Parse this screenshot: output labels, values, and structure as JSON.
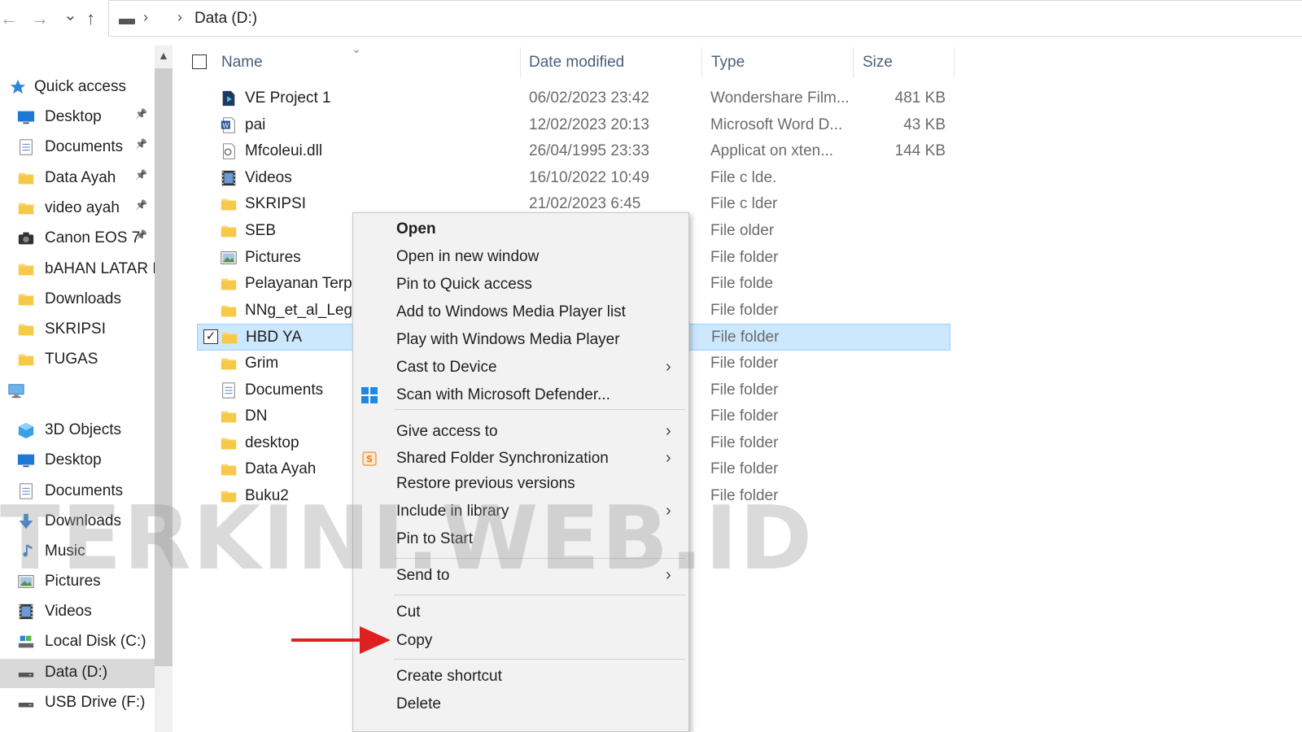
{
  "address": {
    "nav_back": "←",
    "nav_forward": "→",
    "nav_recent": "⌄",
    "nav_up": "↑",
    "path": "Data (D:)"
  },
  "sidebar": {
    "items": [
      {
        "label": "Quick access",
        "icon": "star-icon"
      },
      {
        "label": "Desktop",
        "icon": "desktop-icon",
        "pinned": true
      },
      {
        "label": "Documents",
        "icon": "documents-icon",
        "pinned": true
      },
      {
        "label": "Data Ayah",
        "icon": "folder-icon",
        "pinned": true
      },
      {
        "label": "video ayah",
        "icon": "folder-icon",
        "pinned": true
      },
      {
        "label": "Canon EOS 7",
        "icon": "camera-icon",
        "pinned": true
      },
      {
        "label": "bAHAN LATAR E",
        "icon": "folder-icon"
      },
      {
        "label": "Downloads",
        "icon": "folder-icon"
      },
      {
        "label": "SKRIPSI",
        "icon": "folder-icon"
      },
      {
        "label": "TUGAS",
        "icon": "folder-icon"
      },
      {
        "label": "",
        "icon": "this-pc-icon"
      },
      {
        "label": "3D Objects",
        "icon": "cube-icon"
      },
      {
        "label": "Desktop",
        "icon": "desktop-icon"
      },
      {
        "label": "Documents",
        "icon": "documents-icon"
      },
      {
        "label": "Downloads",
        "icon": "download-icon"
      },
      {
        "label": "Music",
        "icon": "music-icon"
      },
      {
        "label": "Pictures",
        "icon": "pictures-icon"
      },
      {
        "label": "Videos",
        "icon": "videos-icon"
      },
      {
        "label": "Local Disk (C:)",
        "icon": "disk-icon"
      },
      {
        "label": "Data (D:)",
        "icon": "drive-icon",
        "selected": true
      },
      {
        "label": "USB Drive (F:)",
        "icon": "drive-icon"
      }
    ]
  },
  "columns": {
    "name": "Name",
    "date": "Date modified",
    "type": "Type",
    "size": "Size"
  },
  "files": [
    {
      "name": "VE Project 1",
      "date": "06/02/2023 23:42",
      "type": "Wondershare Film...",
      "size": "481 KB",
      "icon": "project-file-icon"
    },
    {
      "name": "pai",
      "date": "12/02/2023 20:13",
      "type": "Microsoft Word D...",
      "size": "43 KB",
      "icon": "word-file-icon"
    },
    {
      "name": "Mfcoleui.dll",
      "date": "26/04/1995 23:33",
      "type": "Applicat on  xten...",
      "size": "144 KB",
      "icon": "dll-file-icon"
    },
    {
      "name": "Videos",
      "date": "16/10/2022 10:49",
      "type": "File  c lde.",
      "size": "",
      "icon": "videos-icon"
    },
    {
      "name": "SKRIPSI",
      "date": "21/02/2023 6:45",
      "type": "File  c lder",
      "size": "",
      "icon": "folder-icon"
    },
    {
      "name": "SEB",
      "date": "",
      "type": "File  older",
      "size": "",
      "icon": "folder-icon"
    },
    {
      "name": "Pictures",
      "date": "",
      "type": "File folder",
      "size": "",
      "icon": "pictures-icon"
    },
    {
      "name": "Pelayanan Terpa",
      "date": "",
      "type": "File folde",
      "size": "",
      "icon": "folder-icon"
    },
    {
      "name": "NNg_et_al_Legic",
      "date": "",
      "type": "File folder",
      "size": "",
      "icon": "folder-icon"
    },
    {
      "name": "HBD YA",
      "date": "",
      "type": "File folder",
      "size": "",
      "icon": "folder-icon",
      "selected": true
    },
    {
      "name": "Grim",
      "date": "",
      "type": "File folder",
      "size": "",
      "icon": "folder-icon"
    },
    {
      "name": "Documents",
      "date": "",
      "type": "File folder",
      "size": "",
      "icon": "documents-icon"
    },
    {
      "name": "DN",
      "date": "",
      "type": "File folder",
      "size": "",
      "icon": "folder-icon"
    },
    {
      "name": "desktop",
      "date": "",
      "type": "File folder",
      "size": "",
      "icon": "folder-icon"
    },
    {
      "name": "Data Ayah",
      "date": "",
      "type": "File folder",
      "size": "",
      "icon": "folder-icon"
    },
    {
      "name": "Buku2",
      "date": "",
      "type": "File folder",
      "size": "",
      "icon": "folder-icon"
    }
  ],
  "context_menu": {
    "items": [
      {
        "label": "Open",
        "bold": true
      },
      {
        "label": "Open in new window"
      },
      {
        "label": "Pin to Quick access"
      },
      {
        "label": "Add to Windows Media Player list"
      },
      {
        "label": "Play with Windows Media Player"
      },
      {
        "label": "Cast to Device",
        "submenu": true
      },
      {
        "label": "Scan with Microsoft Defender...",
        "icon": "defender-icon"
      },
      {
        "label": "Give access to",
        "submenu": true
      },
      {
        "label": "Shared Folder Synchronization",
        "submenu": true,
        "icon": "sync-icon"
      },
      {
        "label": "Restore previous versions"
      },
      {
        "label": "Include in library",
        "submenu": true
      },
      {
        "label": "Pin to Start"
      },
      {
        "label": "Send to",
        "submenu": true
      },
      {
        "label": "Cut"
      },
      {
        "label": "Copy"
      },
      {
        "label": "Create shortcut"
      },
      {
        "label": "Delete"
      }
    ]
  },
  "watermark": "TERKINI.WEB.ID",
  "colors": {
    "accent": "#0078d4",
    "selection": "#cce8ff",
    "folder": "#f7c948",
    "arrow": "#e02020"
  }
}
